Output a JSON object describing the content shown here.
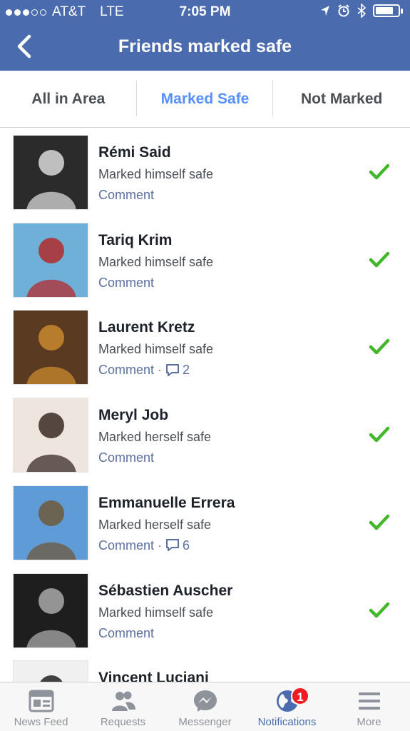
{
  "status_bar": {
    "carrier": "AT&T",
    "network": "LTE",
    "time": "7:05 PM"
  },
  "header": {
    "title": "Friends marked safe",
    "back_icon": "chevron-left-icon"
  },
  "tabs": [
    {
      "label": "All in Area",
      "active": false
    },
    {
      "label": "Marked Safe",
      "active": true
    },
    {
      "label": "Not Marked",
      "active": false
    }
  ],
  "friends": [
    {
      "name": "Rémi Said",
      "status": "Marked himself safe",
      "comment_label": "Comment",
      "comment_count": "",
      "avatar_colors": [
        "#2b2b2b",
        "#d9d9d9"
      ]
    },
    {
      "name": "Tariq Krim",
      "status": "Marked himself safe",
      "comment_label": "Comment",
      "comment_count": "",
      "avatar_colors": [
        "#6fb0d8",
        "#b22b2e"
      ]
    },
    {
      "name": "Laurent Kretz",
      "status": "Marked himself safe",
      "comment_label": "Comment",
      "comment_count": "2",
      "avatar_colors": [
        "#5a3b22",
        "#c98a2e"
      ]
    },
    {
      "name": "Meryl Job",
      "status": "Marked herself safe",
      "comment_label": "Comment",
      "comment_count": "",
      "avatar_colors": [
        "#eee5df",
        "#3a2a25"
      ]
    },
    {
      "name": "Emmanuelle Errera",
      "status": "Marked herself safe",
      "comment_label": "Comment",
      "comment_count": "6",
      "avatar_colors": [
        "#5f9bd6",
        "#6d5a3c"
      ]
    },
    {
      "name": "Sébastien Auscher",
      "status": "Marked himself safe",
      "comment_label": "Comment",
      "comment_count": "",
      "avatar_colors": [
        "#1e1e1e",
        "#a9a9a9"
      ]
    },
    {
      "name": "Vincent Luciani",
      "status": "",
      "comment_label": "",
      "comment_count": "",
      "avatar_colors": [
        "#f0f0f0",
        "#222222"
      ]
    }
  ],
  "tab_bar": [
    {
      "label": "News Feed",
      "icon": "news-feed-icon",
      "active": false,
      "badge": ""
    },
    {
      "label": "Requests",
      "icon": "friend-requests-icon",
      "active": false,
      "badge": ""
    },
    {
      "label": "Messenger",
      "icon": "messenger-icon",
      "active": false,
      "badge": ""
    },
    {
      "label": "Notifications",
      "icon": "globe-icon",
      "active": true,
      "badge": "1"
    },
    {
      "label": "More",
      "icon": "menu-icon",
      "active": false,
      "badge": ""
    }
  ],
  "colors": {
    "brand_blue": "#4a6cae",
    "active_tab": "#5890ff",
    "check_green": "#42b72a",
    "badge_red": "#f01b22"
  }
}
